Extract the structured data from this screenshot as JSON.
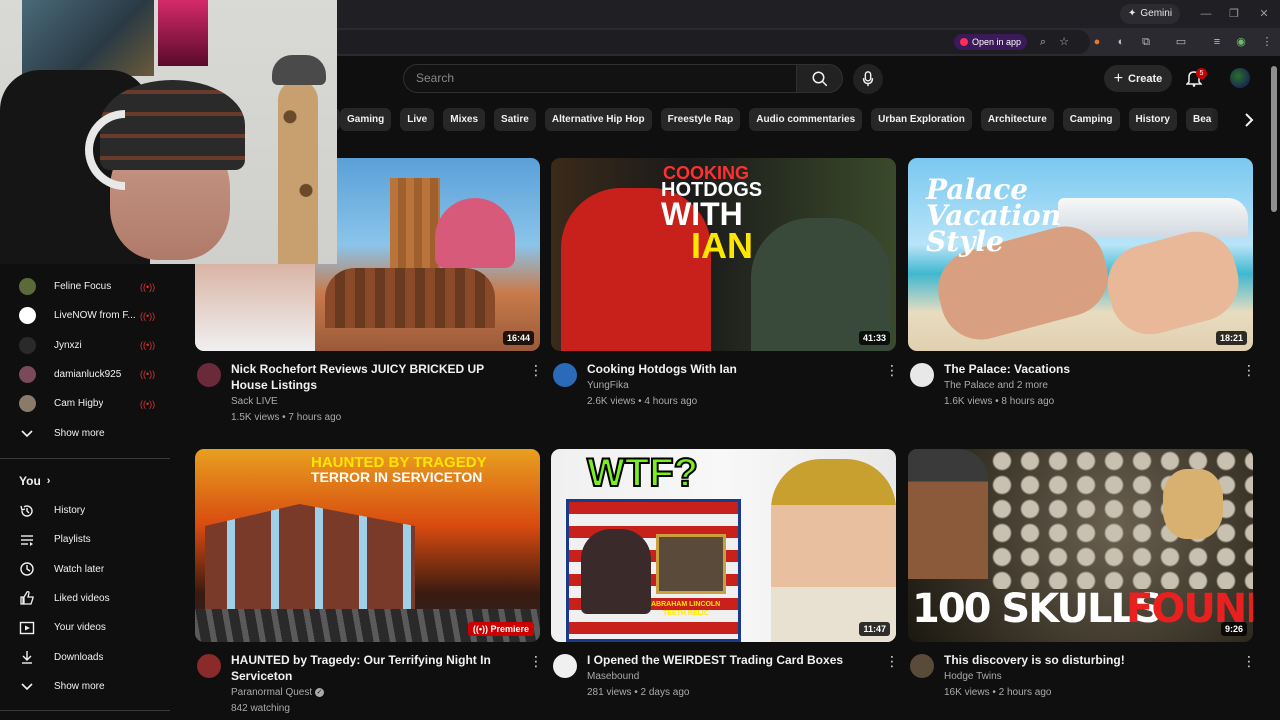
{
  "browser": {
    "gemini_label": "Gemini",
    "open_in_app": "Open in app"
  },
  "header": {
    "search_placeholder": "Search",
    "create_label": "Create",
    "notification_count": "5"
  },
  "chips": [
    "Gaming",
    "Live",
    "Mixes",
    "Satire",
    "Alternative Hip Hop",
    "Freestyle Rap",
    "Audio commentaries",
    "Urban Exploration",
    "Architecture",
    "Camping",
    "History",
    "Bea"
  ],
  "sidebar": {
    "subscriptions": [
      {
        "name": "Feline Focus",
        "color": "#5a6a3a"
      },
      {
        "name": "LiveNOW from F...",
        "color": "#ffffff"
      },
      {
        "name": "Jynxzi",
        "color": "#2a2a2a"
      },
      {
        "name": "damianluck925",
        "color": "#7a4a5a"
      },
      {
        "name": "Cam Higby",
        "color": "#8a7a6a"
      }
    ],
    "show_more_1": "Show more",
    "you_label": "You",
    "you_items": [
      {
        "label": "History",
        "icon": "history-icon"
      },
      {
        "label": "Playlists",
        "icon": "playlists-icon"
      },
      {
        "label": "Watch later",
        "icon": "watch-later-icon"
      },
      {
        "label": "Liked videos",
        "icon": "liked-videos-icon"
      },
      {
        "label": "Your videos",
        "icon": "your-videos-icon"
      },
      {
        "label": "Downloads",
        "icon": "downloads-icon"
      }
    ],
    "show_more_2": "Show more"
  },
  "videos": [
    {
      "title": "Nick Rochefort Reviews JUICY BRICKED UP House Listings",
      "channel": "Sack LIVE",
      "stats": "1.5K views • 7 hours ago",
      "duration": "16:44",
      "thumb_text": ""
    },
    {
      "title": "Cooking Hotdogs With Ian",
      "channel": "YungFika",
      "stats": "2.6K views • 4 hours ago",
      "duration": "41:33",
      "thumb_text_1": "COOKING",
      "thumb_text_2": "HOTDOGS",
      "thumb_text_3": "WITH",
      "thumb_text_4": "IAN"
    },
    {
      "title": "The Palace: Vacations",
      "channel": "The Palace and 2 more",
      "stats": "1.6K views • 8 hours ago",
      "duration": "18:21",
      "thumb_text_1": "Palace",
      "thumb_text_2": "Vacation",
      "thumb_text_3": "Style"
    },
    {
      "title": "HAUNTED by Tragedy: Our Terrifying Night In Serviceton",
      "channel": "Paranormal Quest",
      "stats": "842 watching",
      "badge": "Premiere",
      "thumb_text_1": "HAUNTED BY TRAGEDY",
      "thumb_text_2": "TERROR IN SERVICETON"
    },
    {
      "title": "I Opened the WEIRDEST Trading Card Boxes",
      "channel": "Masebound",
      "stats": "281 views • 2 days ago",
      "duration": "11:47",
      "thumb_text_1": "WTF?",
      "thumb_text_2": "ABRAHAM LINCOLN",
      "thumb_text_3": "TEETH RELIC"
    },
    {
      "title": "This discovery is so disturbing!",
      "channel": "Hodge Twins",
      "stats": "16K views • 2 hours ago",
      "duration": "9:26",
      "thumb_text_1": "100 SKULLS",
      "thumb_text_2": "FOUND!"
    }
  ]
}
